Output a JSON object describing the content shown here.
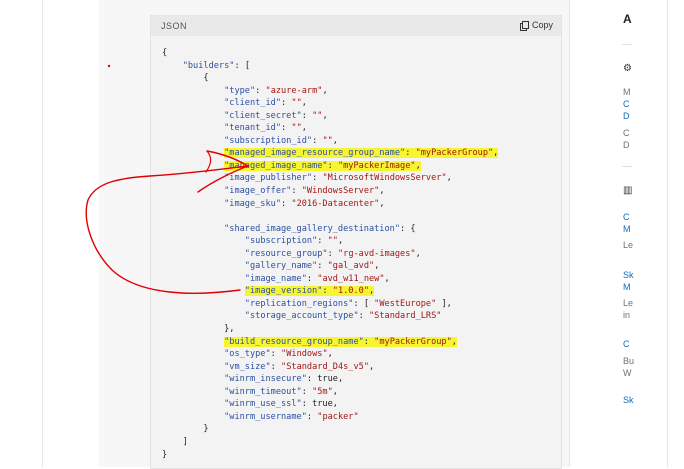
{
  "code_block": {
    "language_label": "JSON",
    "copy_label": "Copy",
    "lines": [
      "{",
      "    \"builders\": [",
      "        {",
      "            \"type\": \"azure-arm\",",
      "            \"client_id\": \"\",",
      "            \"client_secret\": \"\",",
      "            \"tenant_id\": \"\",",
      "            \"subscription_id\": \"\",",
      "            \"managed_image_resource_group_name\": \"myPackerGroup\",",
      "            \"managed_image_name\": \"myPackerImage\",",
      "            \"image_publisher\": \"MicrosoftWindowsServer\",",
      "            \"image_offer\": \"WindowsServer\",",
      "            \"image_sku\": \"2016-Datacenter\",",
      "",
      "            \"shared_image_gallery_destination\": {",
      "                \"subscription\": \"\",",
      "                \"resource_group\": \"rg-avd-images\",",
      "                \"gallery_name\": \"gal_avd\",",
      "                \"image_name\": \"avd_w11_new\",",
      "                \"image_version\": \"1.0.0\",",
      "                \"replication_regions\": [ \"WestEurope\" ],",
      "                \"storage_account_type\": \"Standard_LRS\"",
      "            },",
      "            \"build_resource_group_name\": \"myPackerGroup\",",
      "            \"os_type\": \"Windows\",",
      "            \"vm_size\": \"Standard_D4s_v5\",",
      "            \"winrm_insecure\": true,",
      "            \"winrm_timeout\": \"5m\",",
      "            \"winrm_use_ssl\": true,",
      "            \"winrm_username\": \"packer\"",
      "        }",
      "    ]",
      "}"
    ],
    "highlighted_lines": [
      8,
      9,
      19,
      23
    ]
  },
  "right_sidebar": {
    "heading": "A",
    "items": [
      "M",
      "C",
      "D",
      "C",
      "D",
      "C",
      "M",
      "Le",
      "Sk",
      "M",
      "Le",
      "in",
      "C",
      "Bu",
      "W",
      "Sk"
    ]
  },
  "colors": {
    "highlight": "#f7f531",
    "annotation": "#e00000",
    "key": "#2b4fa3",
    "string": "#a31515"
  }
}
